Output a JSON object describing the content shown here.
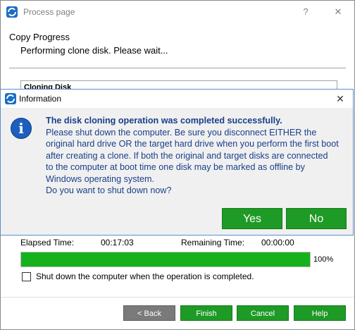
{
  "window": {
    "title": "Process page",
    "help_glyph": "?",
    "close_glyph": "✕"
  },
  "main": {
    "section_title": "Copy Progress",
    "status": "Performing clone disk. Please wait...",
    "panel_title": "Cloning Disk",
    "elapsed_label": "Elapsed Time:",
    "elapsed_value": "00:17:03",
    "remaining_label": "Remaining Time:",
    "remaining_value": "00:00:00",
    "progress_percent": 100,
    "progress_text": "100%",
    "shutdown_checkbox_label": "Shut down the computer when the operation is completed.",
    "shutdown_checked": false
  },
  "footer": {
    "back_label": "< Back",
    "finish_label": "Finish",
    "cancel_label": "Cancel",
    "help_label": "Help"
  },
  "dialog": {
    "title": "Information",
    "close_glyph": "✕",
    "icon_glyph": "i",
    "lines": [
      "The disk cloning operation was completed successfully.",
      "Please shut down the computer. Be sure you disconnect EITHER the",
      "original hard drive OR the target hard drive when you perform the first boot",
      "after creating a clone. If both the original and target disks are connected",
      "to the computer at boot time one disk may be marked as offline by",
      "Windows operating system.",
      "Do you want to shut down now?"
    ],
    "yes_label": "Yes",
    "no_label": "No"
  },
  "colors": {
    "accent_green": "#1e9a26",
    "progress_green": "#16b21d",
    "dialog_text": "#1a3f8a",
    "info_icon_blue": "#1d5fbf"
  }
}
